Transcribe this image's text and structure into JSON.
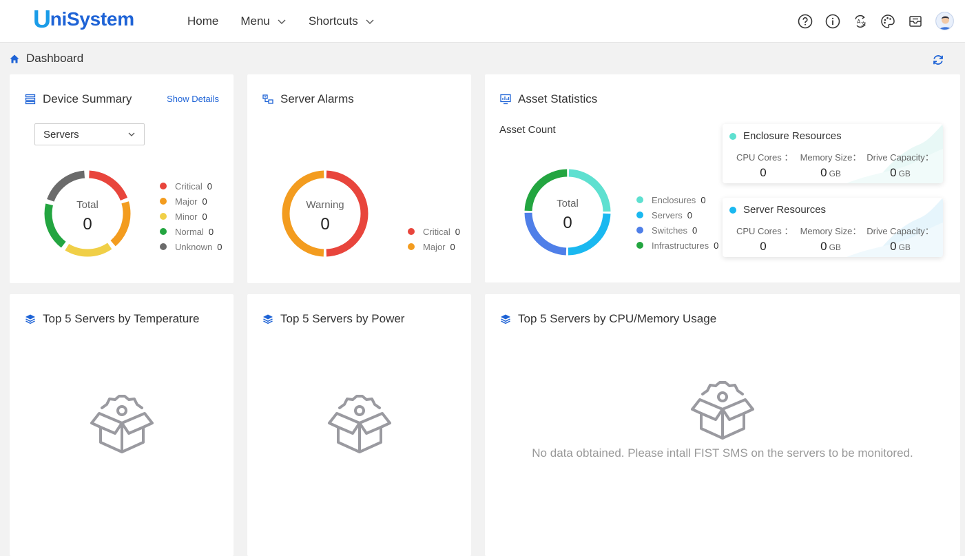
{
  "header": {
    "logo_u": "U",
    "logo_rest": "niSystem",
    "nav": [
      {
        "label": "Home",
        "has_dropdown": false
      },
      {
        "label": "Menu",
        "has_dropdown": true
      },
      {
        "label": "Shortcuts",
        "has_dropdown": true
      }
    ],
    "icons": [
      "help-circle-icon",
      "info-icon",
      "language-switch-icon",
      "palette-icon",
      "message-box-icon",
      "user-avatar"
    ]
  },
  "breadcrumb": {
    "label": "Dashboard"
  },
  "device_summary": {
    "title": "Device Summary",
    "show_details": "Show Details",
    "selected": "Servers",
    "center_label": "Total",
    "center_value": "0",
    "legend": [
      {
        "name": "Critical",
        "value": "0",
        "color": "#e8453c"
      },
      {
        "name": "Major",
        "value": "0",
        "color": "#f39c1f"
      },
      {
        "name": "Minor",
        "value": "0",
        "color": "#f0cf47"
      },
      {
        "name": "Normal",
        "value": "0",
        "color": "#23a540"
      },
      {
        "name": "Unknown",
        "value": "0",
        "color": "#6b6b6b"
      }
    ]
  },
  "server_alarms": {
    "title": "Server Alarms",
    "center_label": "Warning",
    "center_value": "0",
    "legend": [
      {
        "name": "Critical",
        "value": "0",
        "color": "#e8453c"
      },
      {
        "name": "Major",
        "value": "0",
        "color": "#f39c1f"
      }
    ]
  },
  "asset_statistics": {
    "title": "Asset Statistics",
    "subtitle": "Asset Count",
    "center_label": "Total",
    "center_value": "0",
    "legend": [
      {
        "name": "Enclosures",
        "value": "0",
        "color": "#5ee0d0"
      },
      {
        "name": "Servers",
        "value": "0",
        "color": "#1ab8f0"
      },
      {
        "name": "Switches",
        "value": "0",
        "color": "#4f7fe8"
      },
      {
        "name": "Infrastructures",
        "value": "0",
        "color": "#23a540"
      }
    ],
    "resources": [
      {
        "title": "Enclosure Resources",
        "color": "#5ee0d0",
        "cpu_label": "CPU Cores ：",
        "cpu_value": "0",
        "mem_label": "Memory Size：",
        "mem_value": "0",
        "mem_unit": "GB",
        "drive_label": "Drive Capacity：",
        "drive_value": "0",
        "drive_unit": "GB"
      },
      {
        "title": "Server Resources",
        "color": "#1ab8f0",
        "cpu_label": "CPU Cores ：",
        "cpu_value": "0",
        "mem_label": "Memory Size：",
        "mem_value": "0",
        "mem_unit": "GB",
        "drive_label": "Drive Capacity：",
        "drive_value": "0",
        "drive_unit": "GB"
      }
    ]
  },
  "top_temperature": {
    "title": "Top 5 Servers by Temperature"
  },
  "top_power": {
    "title": "Top 5 Servers by Power"
  },
  "top_cpu_memory": {
    "title": "Top 5 Servers by CPU/Memory Usage",
    "empty_message": "No data obtained. Please intall FIST SMS on the servers to be monitored."
  }
}
